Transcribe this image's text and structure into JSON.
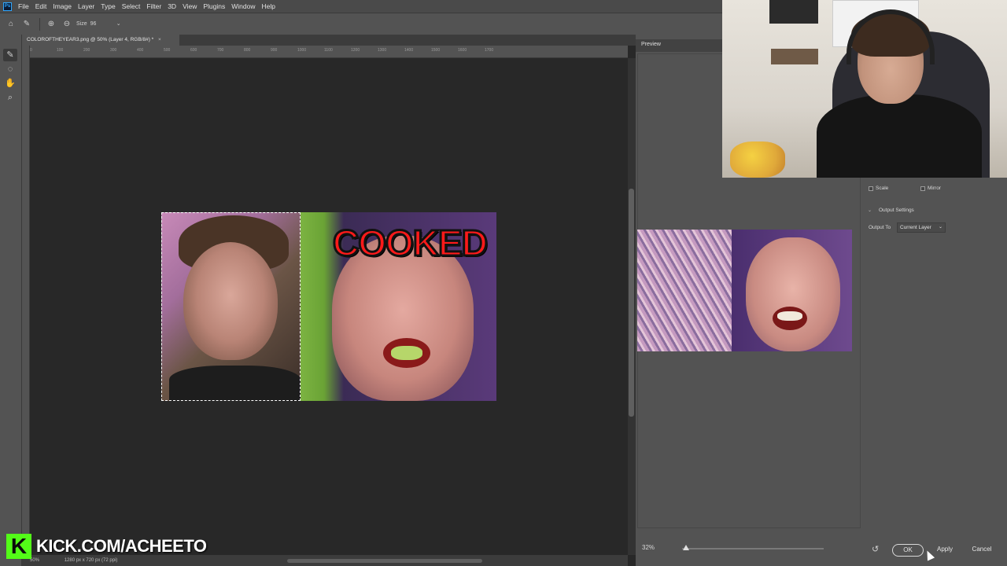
{
  "app": {
    "name": "Adobe Photoshop",
    "logo_text": "Ps"
  },
  "menubar": {
    "items": [
      "File",
      "Edit",
      "Image",
      "Layer",
      "Type",
      "Select",
      "Filter",
      "3D",
      "View",
      "Plugins",
      "Window",
      "Help"
    ]
  },
  "optionsbar": {
    "size_label": "Size",
    "size_value": "96",
    "icons": [
      "home-icon",
      "brush-tool-icon",
      "add-icon",
      "subtract-icon"
    ]
  },
  "document": {
    "tab_title": "COLOROFTHEYEAR3.png @ 50% (Layer 4, RGB/8#) *",
    "tab_close": "×",
    "zoom": "50%",
    "size_info": "1280 px x 720 px (72 ppi)",
    "artwork_text": "COOKED"
  },
  "ruler": {
    "ticks": [
      "0",
      "100",
      "200",
      "300",
      "400",
      "500",
      "600",
      "700",
      "800",
      "900",
      "1000",
      "1100",
      "1200",
      "1300",
      "1400",
      "1500",
      "1600",
      "1700"
    ]
  },
  "toolbar": {
    "tools": [
      "brush-tool-icon",
      "lasso-icon",
      "hand-icon",
      "zoom-icon"
    ]
  },
  "watermark": {
    "logo": "K",
    "text": "KICK.COM/ACHEETO",
    "brand_color": "#53fc18"
  },
  "dialog": {
    "preview_label": "Preview",
    "zoom_value": "32%",
    "zoom_slider_level": 0.03,
    "scale_label": "Scale",
    "scale_checked": false,
    "mirror_label": "Mirror",
    "mirror_checked": false,
    "output_settings_label": "Output Settings",
    "output_to_label": "Output To",
    "output_to_value": "Current Layer",
    "ok_label": "OK",
    "apply_label": "Apply",
    "cancel_label": "Cancel"
  },
  "colors": {
    "accent": "#31a8ff",
    "cooked_text": "#ff1a1a"
  }
}
